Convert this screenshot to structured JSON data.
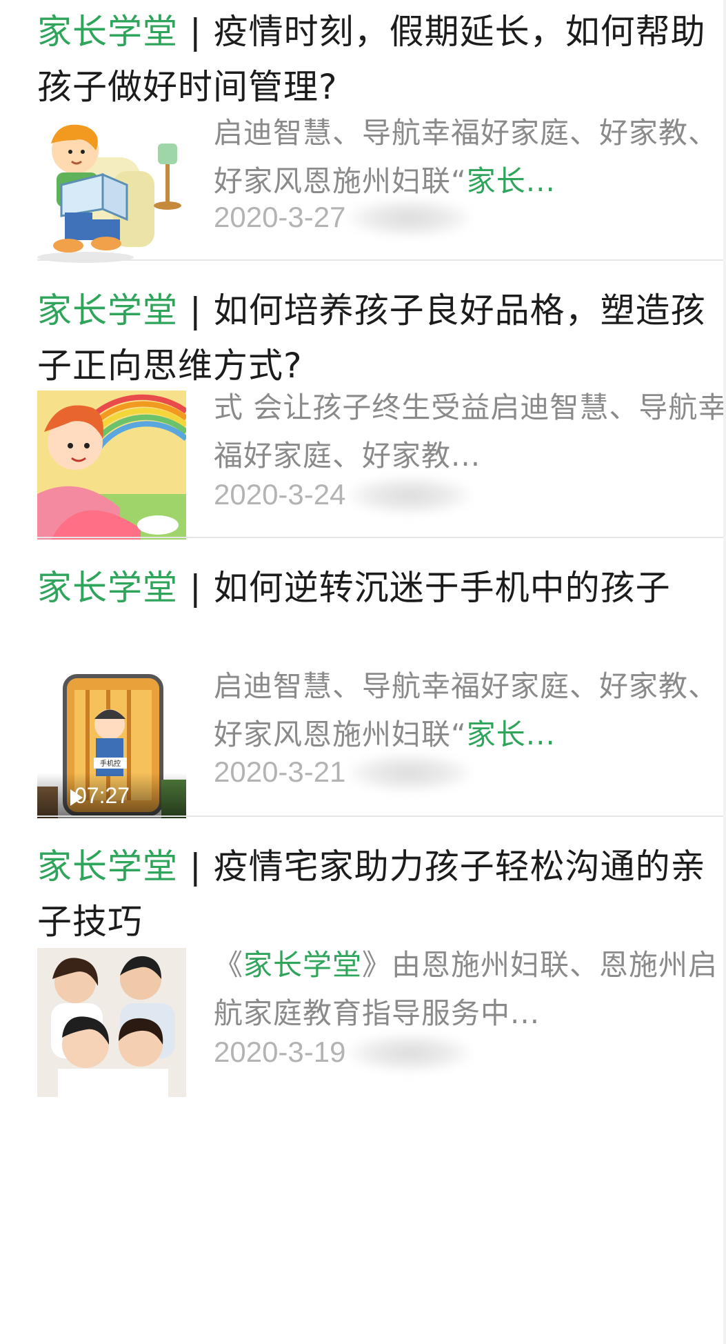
{
  "articles": [
    {
      "title_prefix": "家长学堂",
      "title_rest": " | 疫情时刻，假期延长，如何帮助孩子做好时间管理?",
      "excerpt_plain": "启迪智慧、导航幸福好家庭、好家教、好家风恩施州妇联“",
      "excerpt_hl": "家长...",
      "excerpt_tail": "",
      "date": "2020-3-27",
      "thumbnail": "child-reading-book-icon",
      "duration": ""
    },
    {
      "title_prefix": "家长学堂",
      "title_rest": " | 如何培养孩子良好品格，塑造孩子正向思维方式?",
      "excerpt_plain": "式 会让孩子终生受益启迪智慧、导航幸福好家庭、好家教...",
      "excerpt_hl": "",
      "excerpt_tail": "",
      "date": "2020-3-24",
      "thumbnail": "girl-rainbow-icon",
      "duration": ""
    },
    {
      "title_prefix": "家长学堂",
      "title_rest": " | 如何逆转沉迷于手机中的孩子",
      "excerpt_plain": "启迪智慧、导航幸福好家庭、好家教、好家风恩施州妇联“",
      "excerpt_hl": "家长...",
      "excerpt_tail": "",
      "date": "2020-3-21",
      "thumbnail": "child-in-phone-icon",
      "phone_label": "手机控",
      "duration": "07:27"
    },
    {
      "title_prefix": "家长学堂",
      "title_rest": " | 疫情宅家助力孩子轻松沟通的亲子技巧",
      "excerpt_pre": "《",
      "excerpt_hl": "家长学堂",
      "excerpt_tail": "》由恩施州妇联、恩施州启航家庭教育指导服务中...",
      "date": "2020-3-19",
      "thumbnail": "family-photo-icon",
      "duration": ""
    }
  ],
  "colors": {
    "accent": "#2ea55b",
    "title": "#1c1c1c",
    "excerpt": "#8a8a8a",
    "date": "#b3b3b3"
  }
}
